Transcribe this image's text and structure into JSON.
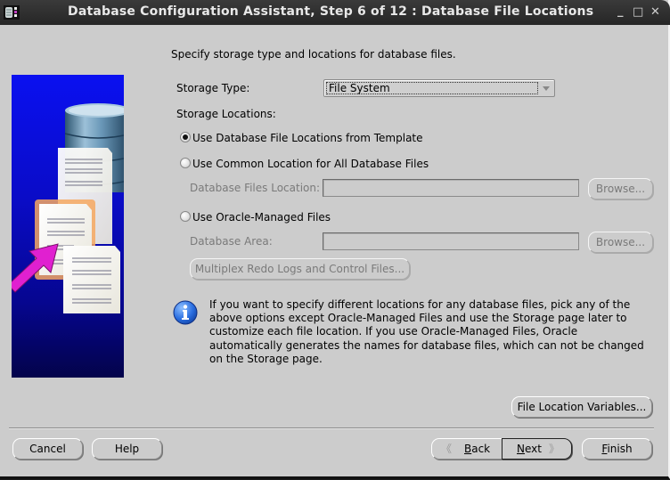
{
  "window": {
    "title": "Database Configuration Assistant, Step 6 of 12 : Database File Locations",
    "controls": {
      "minimize": "_",
      "maximize": "□",
      "close": "✕"
    }
  },
  "intro_text": "Specify storage type and locations for database files.",
  "storage_type": {
    "label": "Storage Type:",
    "selected": "File System"
  },
  "storage_locations": {
    "label": "Storage Locations:",
    "options": [
      {
        "label": "Use Database File Locations from Template",
        "checked": true
      },
      {
        "label": "Use Common Location for All Database Files",
        "checked": false
      },
      {
        "label": "Use Oracle-Managed Files",
        "checked": false
      }
    ],
    "database_files_location": {
      "label": "Database Files Location:",
      "value": "",
      "browse": "Browse..."
    },
    "database_area": {
      "label": "Database Area:",
      "value": "",
      "browse": "Browse..."
    },
    "multiplex_button": "Multiplex Redo Logs and Control Files..."
  },
  "info": {
    "icon": "info-icon",
    "text": "If you want to specify different locations for any database files, pick any of the above options except Oracle-Managed Files and use the Storage page later to customize each file location. If you use Oracle-Managed Files, Oracle automatically generates the names for database files, which can not be changed on the Storage page."
  },
  "file_location_variables_button": "File Location Variables...",
  "footer": {
    "cancel": "Cancel",
    "help": "Help",
    "back": {
      "mnemonic": "B",
      "rest": "ack"
    },
    "next": {
      "mnemonic": "N",
      "rest": "ext"
    },
    "finish": {
      "mnemonic": "F",
      "rest": "inish"
    }
  },
  "colors": {
    "titlebar": "#2e2e2e",
    "dialog_bg": "#cccccc",
    "illustration_top": "#0a10f0",
    "illustration_bottom": "#03034a",
    "arrow": "#e020d0",
    "info_blue": "#2a6ee0"
  }
}
